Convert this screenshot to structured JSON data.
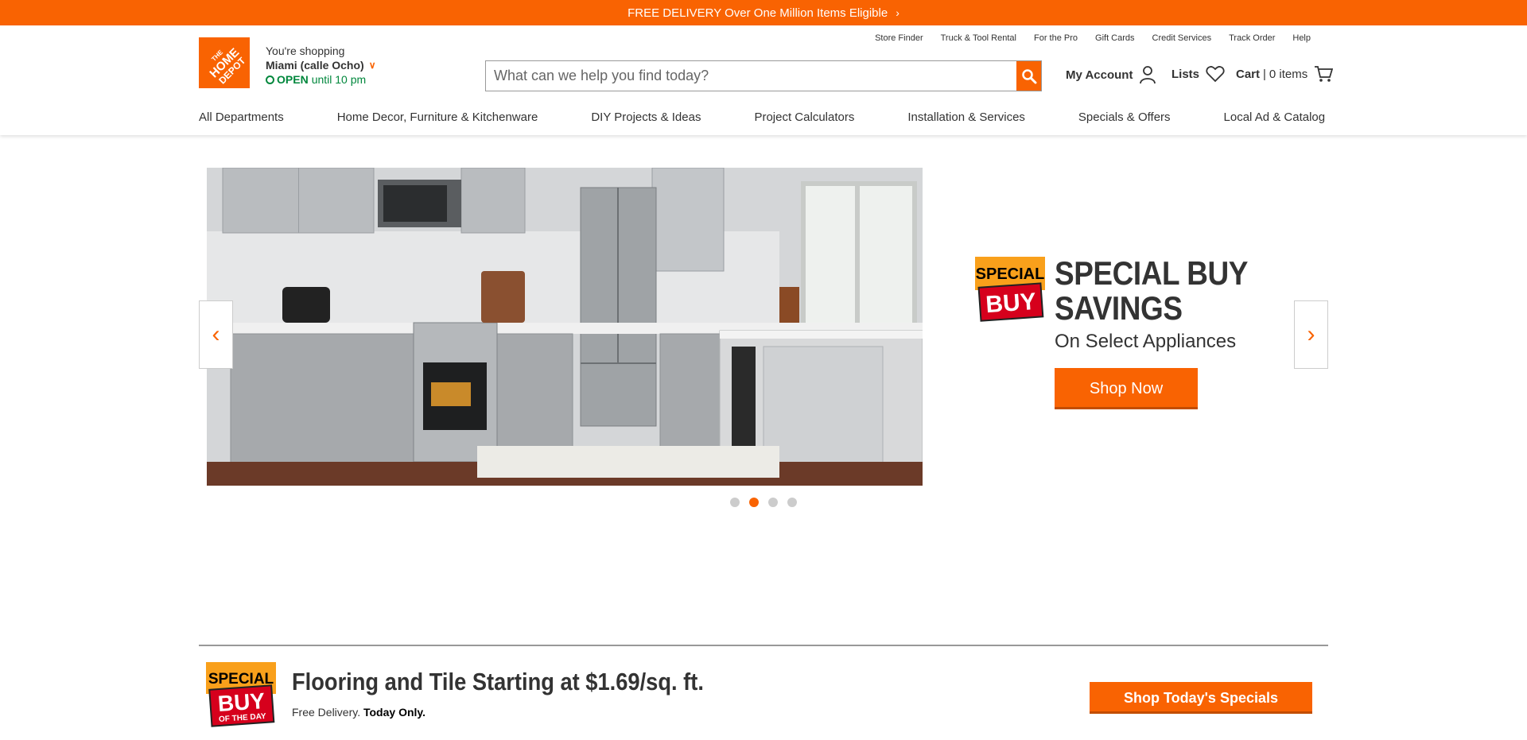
{
  "banner": {
    "text": "FREE DELIVERY Over One Million Items Eligible"
  },
  "logo": {
    "text": "THE HOME DEPOT"
  },
  "store": {
    "line1": "You're shopping",
    "name": "Miami (calle Ocho)",
    "status": "OPEN",
    "hours": "until 10 pm"
  },
  "utility_links": [
    "Store Finder",
    "Truck & Tool Rental",
    "For the Pro",
    "Gift Cards",
    "Credit Services",
    "Track Order",
    "Help"
  ],
  "search": {
    "placeholder": "What can we help you find today?"
  },
  "account": {
    "label": "My Account"
  },
  "lists": {
    "label": "Lists"
  },
  "cart": {
    "label": "Cart",
    "separator": "|",
    "count": "0 items"
  },
  "nav": [
    "All Departments",
    "Home Decor, Furniture & Kitchenware",
    "DIY Projects & Ideas",
    "Project Calculators",
    "Installation & Services",
    "Specials & Offers",
    "Local Ad & Catalog"
  ],
  "hero": {
    "badge_top": "SPECIAL",
    "badge_bottom": "BUY",
    "title_line1": "SPECIAL BUY",
    "title_line2": "SAVINGS",
    "subtitle": "On Select Appliances",
    "cta": "Shop Now",
    "active_slide": 2,
    "total_slides": 4
  },
  "daily": {
    "badge_top": "SPECIAL",
    "badge_mid": "BUY",
    "badge_bottom": "OF THE DAY",
    "title": "Flooring and Tile Starting at $1.69/sq. ft.",
    "sub_plain": "Free Delivery.",
    "sub_bold": "Today Only.",
    "cta": "Shop Today's Specials"
  },
  "colors": {
    "brand": "#f96302",
    "open": "#00873c"
  }
}
